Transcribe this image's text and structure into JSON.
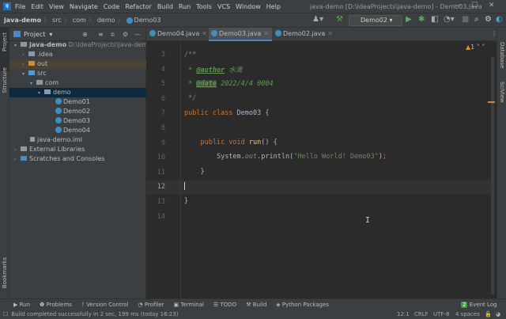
{
  "menu": {
    "items": [
      "File",
      "Edit",
      "View",
      "Navigate",
      "Code",
      "Refactor",
      "Build",
      "Run",
      "Tools",
      "VCS",
      "Window",
      "Help"
    ],
    "window_title": "java-demo [D:\\IdeaProjects\\java-demo] - Demo03.java"
  },
  "breadcrumb": [
    "java-demo",
    "src",
    "com",
    "demo",
    "Demo03"
  ],
  "toolbar": {
    "run_config": "Demo02"
  },
  "left_strip": {
    "project": "Project",
    "structure": "Structure",
    "bookmarks": "Bookmarks"
  },
  "right_strip": {
    "database": "Database",
    "sciview": "SciView"
  },
  "project_panel": {
    "title": "Project",
    "root": "java-demo",
    "root_path": "D:\\IdeaProjects\\java-demo",
    "items": [
      ".idea",
      "out",
      "src",
      "com",
      "demo",
      "Demo01",
      "Demo02",
      "Demo03",
      "Demo04",
      "java-demo.iml",
      "External Libraries",
      "Scratches and Consoles"
    ]
  },
  "tabs": [
    "Demo04.java",
    "Demo03.java",
    "Demo02.java"
  ],
  "editor": {
    "warnings": "1",
    "line_numbers": [
      "3",
      "4",
      "5",
      "6",
      "7",
      "8",
      "9",
      "10",
      "11",
      "12",
      "13",
      "14"
    ],
    "author_tag": "@author",
    "author": "水滴",
    "date_tag": "@date",
    "date": "2022/4/4 0004",
    "class_name": "Demo03",
    "method": "run",
    "system": "System",
    "out": "out",
    "println": "println",
    "string": "\"Hello World! Demo03\""
  },
  "bottom_tools": [
    "Run",
    "Problems",
    "Version Control",
    "Profiler",
    "Terminal",
    "TODO",
    "Build",
    "Python Packages"
  ],
  "event_log": {
    "label": "Event Log",
    "count": "2"
  },
  "status": {
    "message": "Build completed successfully in 2 sec, 199 ms (today 16:23)",
    "position": "12:1",
    "line_sep": "CRLF",
    "encoding": "UTF-8",
    "indent": "4 spaces"
  }
}
